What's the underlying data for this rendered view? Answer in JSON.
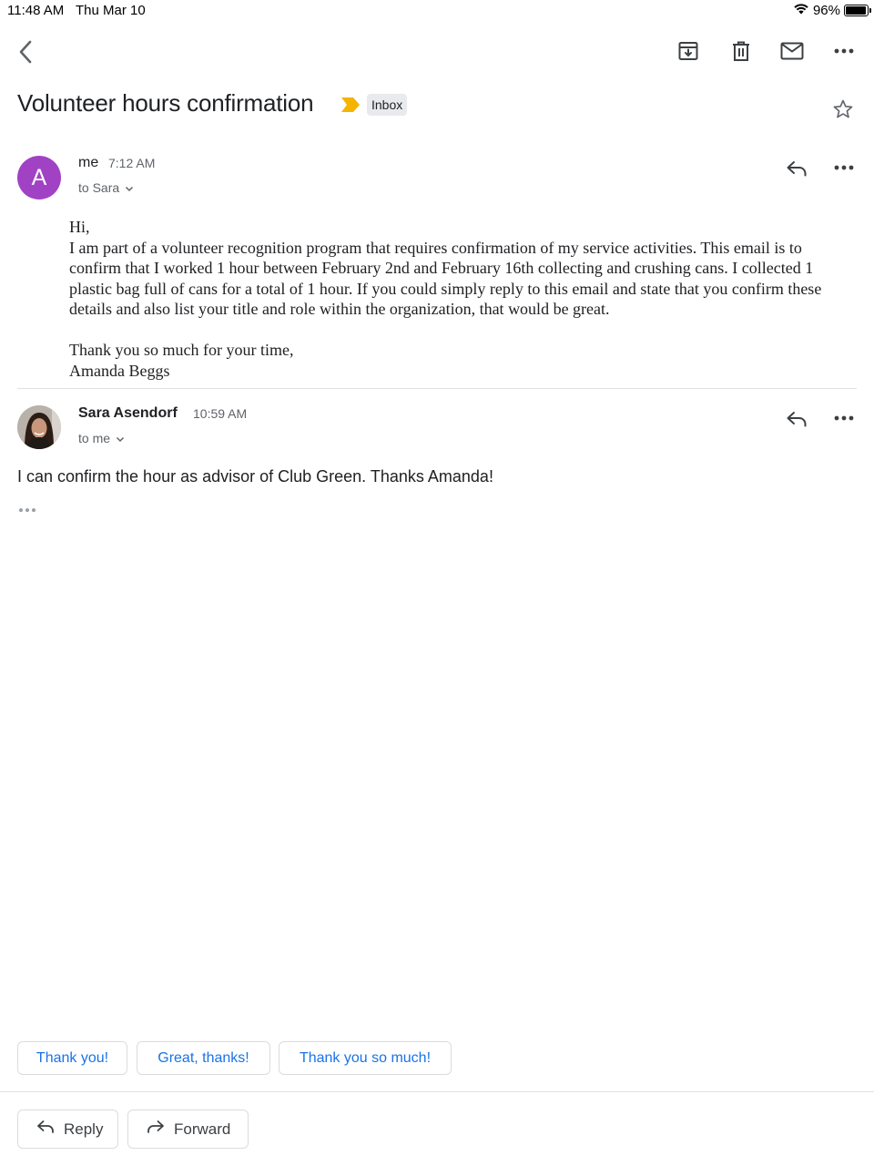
{
  "status_bar": {
    "time": "11:48 AM",
    "date": "Thu Mar 10",
    "battery": "96%",
    "battery_level": 0.96
  },
  "toolbar": {
    "icons": [
      "back-arrow-icon",
      "archive-icon",
      "trash-icon",
      "mail-icon",
      "more-icon"
    ]
  },
  "thread": {
    "subject": "Volunteer hours confirmation",
    "label": "Inbox",
    "important_color": "#f4b400"
  },
  "messages": [
    {
      "avatar_letter": "A",
      "avatar_color": "#a142c5",
      "sender": "me",
      "time": "7:12 AM",
      "recipient": "to Sara",
      "body": {
        "greeting": "Hi,",
        "paragraph": "I am part of a volunteer recognition program that requires confirmation of my service activities. This email is to confirm that I worked 1 hour between February 2nd and February 16th collecting and crushing cans. I collected 1 plastic bag full of cans for a total of 1 hour. If you could simply reply to this email and state that you confirm these details and also list your title and role within the organization, that would be great.",
        "closing": "Thank you so much for your time,",
        "signature": "Amanda Beggs"
      }
    },
    {
      "sender": "Sara Asendorf",
      "time": "10:59 AM",
      "recipient": "to me",
      "body": "I can confirm the hour as advisor of Club Green. Thanks Amanda!"
    }
  ],
  "smart_replies": [
    "Thank you!",
    "Great, thanks!",
    "Thank you so much!"
  ],
  "actions": {
    "reply": "Reply",
    "forward": "Forward"
  },
  "colors": {
    "accent": "#1a73e8",
    "label_bg": "#e8eaed"
  }
}
